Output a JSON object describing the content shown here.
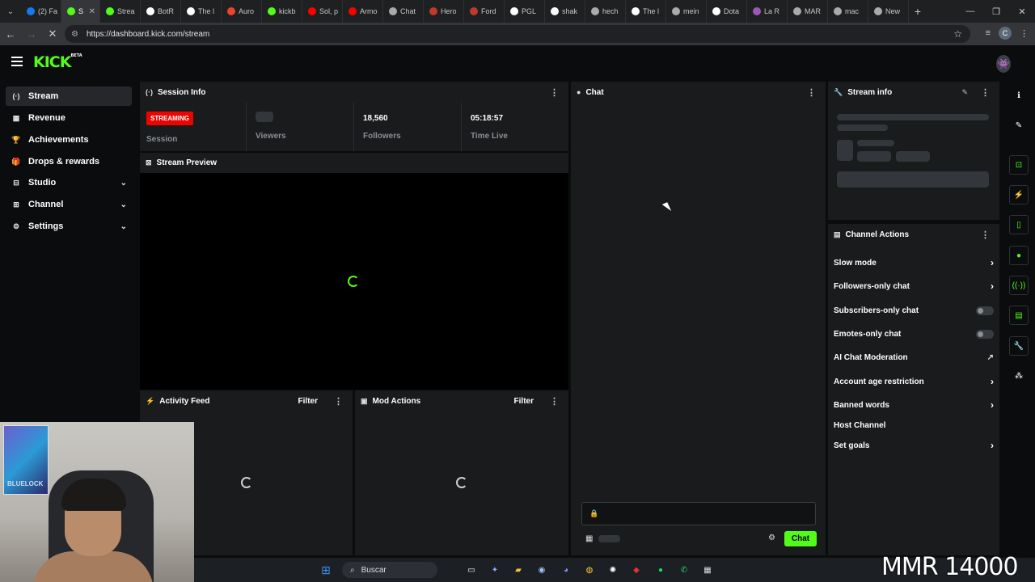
{
  "browser": {
    "tabs": [
      {
        "label": "(2) Fa",
        "color": "#1877f2"
      },
      {
        "label": "S",
        "color": "#53fc18",
        "active": true
      },
      {
        "label": "Strea",
        "color": "#53fc18"
      },
      {
        "label": "BotR",
        "color": "#ffffff"
      },
      {
        "label": "The l",
        "color": "#ffffff"
      },
      {
        "label": "Auro",
        "color": "#e8452c"
      },
      {
        "label": "kickb",
        "color": "#53fc18"
      },
      {
        "label": "Sol, p",
        "color": "#ff0000"
      },
      {
        "label": "Armo",
        "color": "#ff0000"
      },
      {
        "label": "Chat",
        "color": "#aaaaaa"
      },
      {
        "label": "Hero",
        "color": "#c0392b"
      },
      {
        "label": "Ford",
        "color": "#c0392b"
      },
      {
        "label": "PGL",
        "color": "#ffffff"
      },
      {
        "label": "shak",
        "color": "#ffffff"
      },
      {
        "label": "hech",
        "color": "#aaaaaa"
      },
      {
        "label": "The l",
        "color": "#ffffff"
      },
      {
        "label": "mein",
        "color": "#aaaaaa"
      },
      {
        "label": "Dota",
        "color": "#ffffff"
      },
      {
        "label": "La R",
        "color": "#9b59b6"
      },
      {
        "label": "MAR",
        "color": "#aaaaaa"
      },
      {
        "label": "mac",
        "color": "#aaaaaa"
      },
      {
        "label": "New",
        "color": "#aaaaaa"
      }
    ],
    "url": "https://dashboard.kick.com/stream",
    "profile_initial": "C"
  },
  "brand": {
    "logo": "KICK",
    "logo_badge": "BETA",
    "accent": "#53fc18"
  },
  "sidebar": {
    "items": [
      {
        "label": "Stream",
        "icon": "broadcast-icon",
        "glyph": "(·)",
        "active": true,
        "expandable": false
      },
      {
        "label": "Revenue",
        "icon": "revenue-icon",
        "glyph": "▦",
        "active": false,
        "expandable": false
      },
      {
        "label": "Achievements",
        "icon": "trophy-icon",
        "glyph": "🏆",
        "active": false,
        "expandable": false
      },
      {
        "label": "Drops & rewards",
        "icon": "gift-icon",
        "glyph": "🎁",
        "active": false,
        "expandable": false
      },
      {
        "label": "Studio",
        "icon": "studio-icon",
        "glyph": "⊟",
        "active": false,
        "expandable": true
      },
      {
        "label": "Channel",
        "icon": "channel-icon",
        "glyph": "⊞",
        "active": false,
        "expandable": true
      },
      {
        "label": "Settings",
        "icon": "settings-icon",
        "glyph": "⚙",
        "active": false,
        "expandable": true
      }
    ]
  },
  "session_info": {
    "title": "Session Info",
    "status_badge": "STREAMING",
    "session_label": "Session",
    "viewers_label": "Viewers",
    "followers_value": "18,560",
    "followers_label": "Followers",
    "time_live_value": "05:18:57",
    "time_live_label": "Time Live"
  },
  "stream_preview": {
    "title": "Stream Preview"
  },
  "activity_feed": {
    "title": "Activity Feed",
    "filter_label": "Filter"
  },
  "mod_actions": {
    "title": "Mod Actions",
    "filter_label": "Filter"
  },
  "chat": {
    "title": "Chat",
    "send_label": "Chat"
  },
  "stream_info": {
    "title": "Stream info"
  },
  "channel_actions": {
    "title": "Channel Actions",
    "items": [
      {
        "label": "Slow mode",
        "control": "arrow"
      },
      {
        "label": "Followers-only chat",
        "control": "arrow"
      },
      {
        "label": "Subscribers-only chat",
        "control": "toggle",
        "enabled": false
      },
      {
        "label": "Emotes-only chat",
        "control": "toggle",
        "enabled": false
      },
      {
        "label": "AI Chat Moderation",
        "control": "external"
      },
      {
        "label": "Account age restriction",
        "control": "arrow"
      },
      {
        "label": "Banned words",
        "control": "arrow"
      },
      {
        "label": "Host Channel",
        "control": "none"
      },
      {
        "label": "Set goals",
        "control": "arrow"
      }
    ]
  },
  "webcam": {
    "poster_text": "BLUELOCK"
  },
  "taskbar": {
    "search_placeholder": "Buscar"
  },
  "overlay": {
    "mmr_text": "MMR 14000"
  }
}
